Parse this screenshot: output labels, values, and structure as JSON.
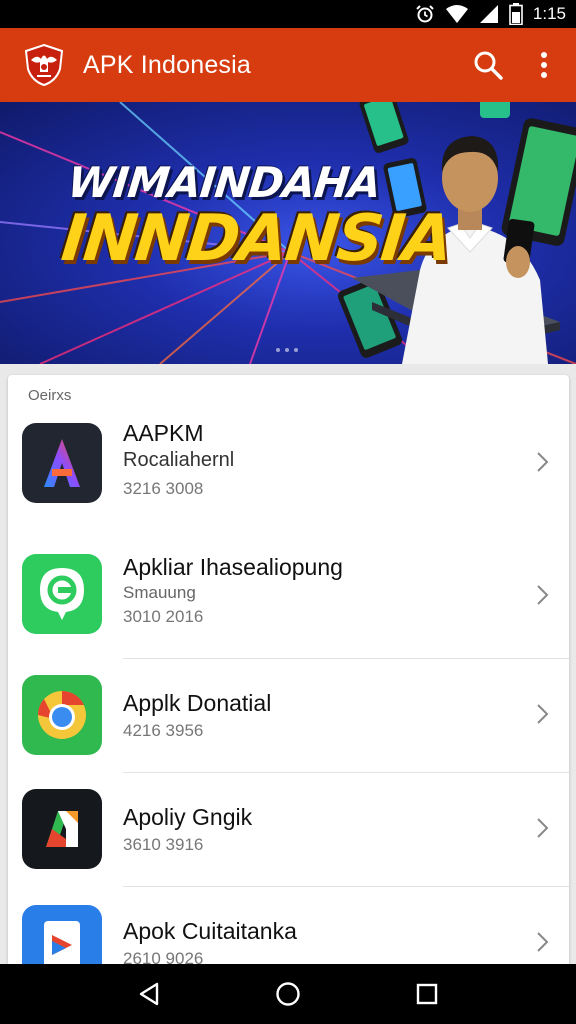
{
  "status_bar": {
    "time": "1:15",
    "icons": [
      "alarm-icon",
      "wifi-icon",
      "signal-icon",
      "battery-icon"
    ]
  },
  "app_bar": {
    "title": "APK Indonesia",
    "background": "#d63c0f",
    "actions": [
      "search-icon",
      "more-vert-icon"
    ]
  },
  "banner": {
    "line1": "WIMAINDAHA",
    "line2": "INNDANSIA"
  },
  "list": {
    "header": "Oeirxs",
    "items": [
      {
        "name": "AAPKM",
        "subtitle": "Rocaliahernl",
        "meta": "3216 3008",
        "icon": "apkm-a-icon"
      },
      {
        "name": "Apkliar Ihasealiopung",
        "subtitle": "Smauung",
        "meta": "3010 2016",
        "icon": "green-chat-icon"
      },
      {
        "name": "Applk Donatial",
        "subtitle": "",
        "meta": "4216 3956",
        "icon": "browser-icon"
      },
      {
        "name": "Apoliy Gngik",
        "subtitle": "",
        "meta": "3610 3916",
        "icon": "colorful-k-icon"
      },
      {
        "name": "Apok Cuitaitanka",
        "subtitle": "",
        "meta": "2610 9026",
        "icon": "blue-tile-icon"
      }
    ]
  },
  "nav_bar": {
    "buttons": [
      "back-icon",
      "home-icon",
      "recents-icon"
    ]
  }
}
